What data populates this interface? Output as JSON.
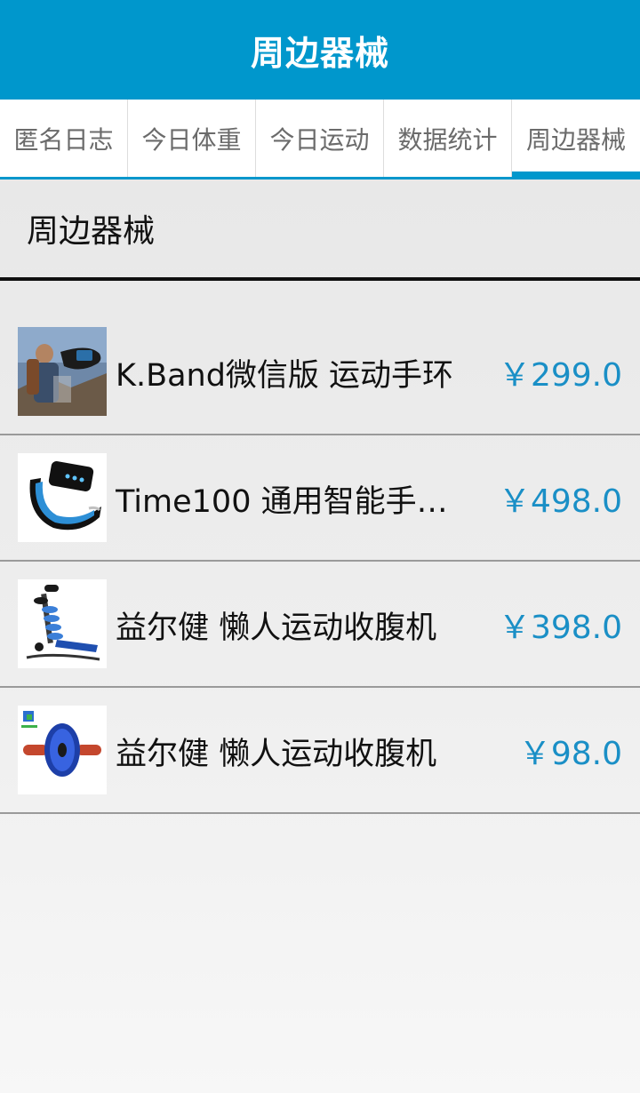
{
  "app_bar": {
    "title": "周边器械"
  },
  "tabs": [
    {
      "label": "匿名日志"
    },
    {
      "label": "今日体重"
    },
    {
      "label": "今日运动"
    },
    {
      "label": "数据统计"
    },
    {
      "label": "周边器械"
    }
  ],
  "section": {
    "title": "周边器械"
  },
  "products": [
    {
      "name": "K.Band微信版 运动手环",
      "price": "￥299.0"
    },
    {
      "name": "Time100 通用智能手…",
      "price": "￥498.0"
    },
    {
      "name": "益尔健 懒人运动收腹机",
      "price": "￥398.0"
    },
    {
      "name": "益尔健 懒人运动收腹机",
      "price": "￥98.0"
    }
  ],
  "colors": {
    "accent": "#0097cc",
    "price": "#1a8fc6"
  }
}
